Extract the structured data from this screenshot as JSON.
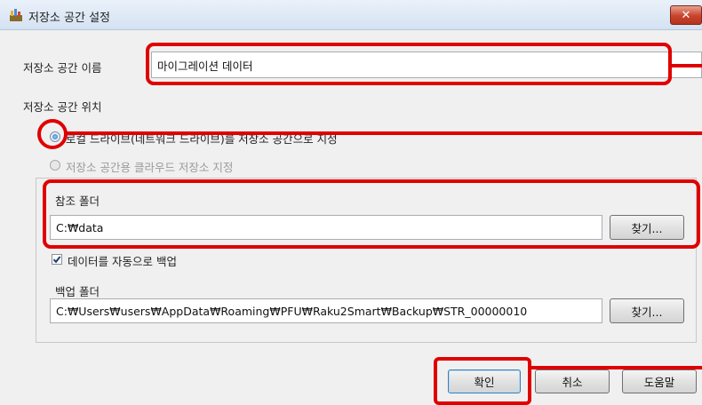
{
  "window": {
    "title": "저장소 공간 설정",
    "close_glyph": "✕"
  },
  "storage_name": {
    "label": "저장소 공간 이름",
    "value": "마이그레이션 데이터"
  },
  "location": {
    "label": "저장소 공간 위치",
    "option_local": "로컬 드라이브(네트워크 드라이브)를 저장소 공간으로 지정",
    "option_cloud": "저장소 공간용 클라우드 저장소 지정",
    "selected": "local"
  },
  "reference_folder": {
    "label": "참조 폴더",
    "value": "C:₩data",
    "browse_label": "찾기..."
  },
  "auto_backup": {
    "label": "데이터를 자동으로 백업",
    "checked": true
  },
  "backup_folder": {
    "label": "백업 폴더",
    "value": "C:₩Users₩users₩AppData₩Roaming₩PFU₩Raku2Smart₩Backup₩STR_00000010",
    "browse_label": "찾기..."
  },
  "buttons": {
    "ok": "확인",
    "cancel": "취소",
    "help": "도움말"
  },
  "colors": {
    "annotation": "#e00000",
    "selected_radio": "#1f6fc2"
  }
}
